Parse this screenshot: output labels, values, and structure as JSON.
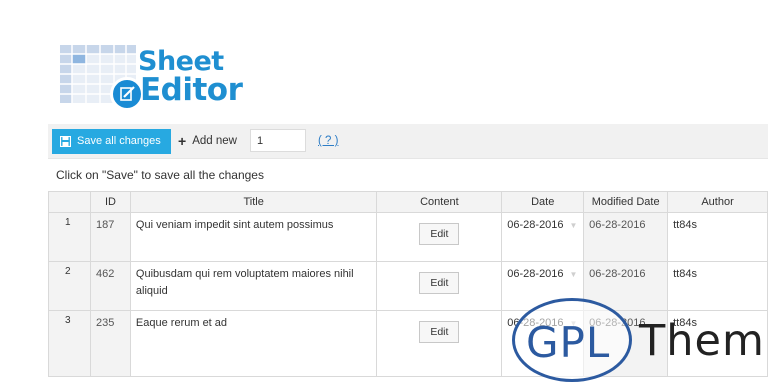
{
  "logo": {
    "line1": "Sheet",
    "line2": "Editor"
  },
  "toolbar": {
    "save_label": "Save all changes",
    "add_new_label": "Add new",
    "quantity_value": "1",
    "help_label": "( ? )"
  },
  "hint": "Click on \"Save\" to save all the changes",
  "table": {
    "headers": [
      "",
      "ID",
      "Title",
      "Content",
      "Date",
      "Modified Date",
      "Author"
    ],
    "rows": [
      {
        "num": "1",
        "id": "187",
        "title": "Qui veniam impedit sint autem possimus",
        "content": "Edit",
        "date": "06-28-2016",
        "modified": "06-28-2016",
        "author": "tt84s"
      },
      {
        "num": "2",
        "id": "462",
        "title": "Quibusdam qui rem voluptatem maiores nihil aliquid",
        "content": "Edit",
        "date": "06-28-2016",
        "modified": "06-28-2016",
        "author": "tt84s"
      },
      {
        "num": "3",
        "id": "235",
        "title": "Eaque rerum et ad",
        "content": "Edit",
        "date": "06-28-2016",
        "modified": "06-28-2016",
        "author": "tt84s"
      }
    ]
  },
  "watermark": {
    "left": "GPL",
    "right": "Them"
  },
  "colors": {
    "accent": "#27a9e1",
    "logo": "#1f8fd1",
    "watermark": "#2c5aa0"
  }
}
